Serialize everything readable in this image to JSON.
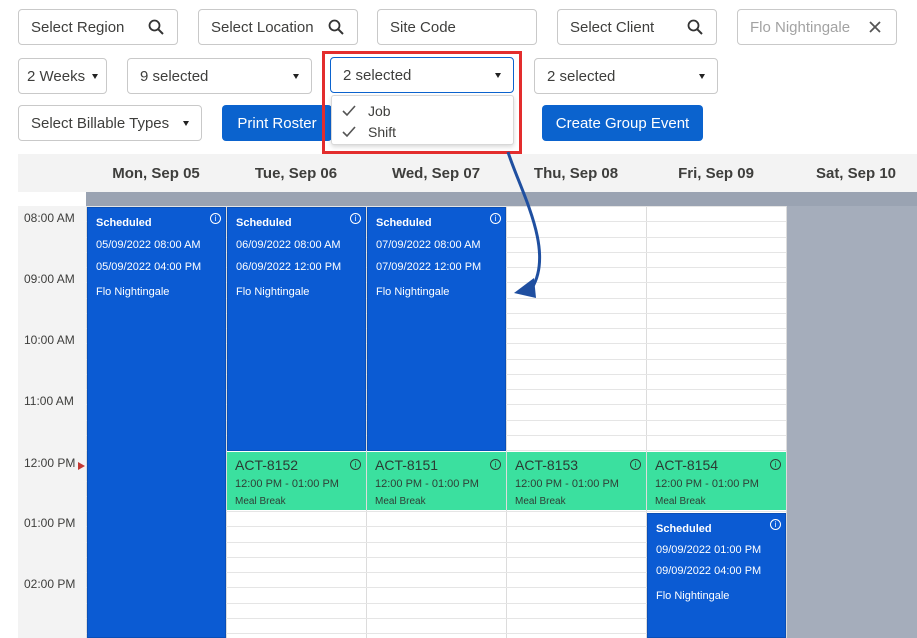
{
  "filters": {
    "region_placeholder": "Select Region",
    "location_placeholder": "Select Location",
    "site_code_placeholder": "Site Code",
    "client_placeholder": "Select Client",
    "employee_value": "Flo Nightingale"
  },
  "selects": {
    "range": "2 Weeks",
    "sel1": "9 selected",
    "sel2": "2 selected",
    "sel3": "2 selected",
    "billable": "Select Billable Types"
  },
  "dropdown_options": [
    "Job",
    "Shift"
  ],
  "buttons": {
    "print_roster": "Print Roster",
    "create_group_event": "Create Group Event"
  },
  "days": [
    "Mon, Sep 05",
    "Tue, Sep 06",
    "Wed, Sep 07",
    "Thu, Sep 08",
    "Fri, Sep 09",
    "Sat, Sep 10"
  ],
  "times": [
    "08:00 AM",
    "09:00 AM",
    "10:00 AM",
    "11:00 AM",
    "12:00 PM",
    "01:00 PM",
    "02:00 PM"
  ],
  "scheduled_events": [
    {
      "status": "Scheduled",
      "start": "05/09/2022 08:00 AM",
      "end": "05/09/2022 04:00 PM",
      "person": "Flo Nightingale"
    },
    {
      "status": "Scheduled",
      "start": "06/09/2022 08:00 AM",
      "end": "06/09/2022 12:00 PM",
      "person": "Flo Nightingale"
    },
    {
      "status": "Scheduled",
      "start": "07/09/2022 08:00 AM",
      "end": "07/09/2022 12:00 PM",
      "person": "Flo Nightingale"
    },
    {
      "status": "Scheduled",
      "start": "09/09/2022 01:00 PM",
      "end": "09/09/2022 04:00 PM",
      "person": "Flo Nightingale"
    }
  ],
  "activity_events": [
    {
      "code": "ACT-8152",
      "time": "12:00 PM - 01:00 PM",
      "note": "Meal Break"
    },
    {
      "code": "ACT-8151",
      "time": "12:00 PM - 01:00 PM",
      "note": "Meal Break"
    },
    {
      "code": "ACT-8153",
      "time": "12:00 PM - 01:00 PM",
      "note": "Meal Break"
    },
    {
      "code": "ACT-8154",
      "time": "12:00 PM - 01:00 PM",
      "note": "Meal Break"
    }
  ],
  "colors": {
    "brand_blue": "#0b63ce",
    "event_blue": "#0b5bd3",
    "event_green": "#3be09f",
    "highlight": "#e32d2d",
    "arrow": "#1f4fa0"
  }
}
